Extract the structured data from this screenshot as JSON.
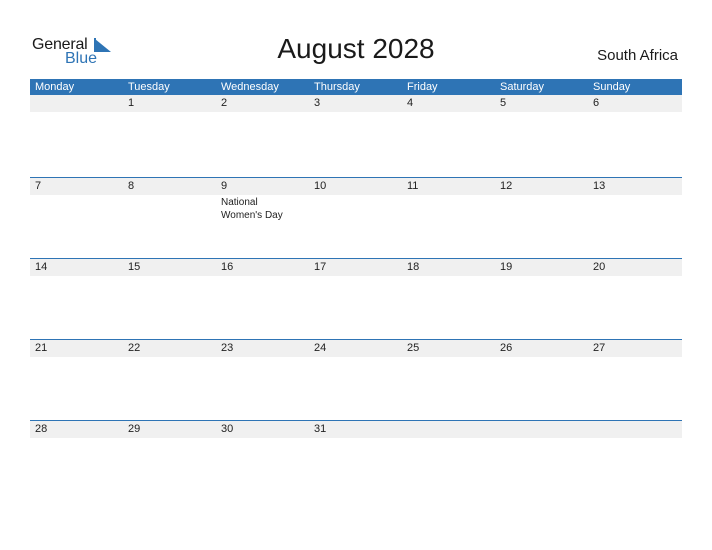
{
  "logo": {
    "general": "General",
    "blue": "Blue"
  },
  "title": "August 2028",
  "country": "South Africa",
  "weekdays": [
    "Monday",
    "Tuesday",
    "Wednesday",
    "Thursday",
    "Friday",
    "Saturday",
    "Sunday"
  ],
  "weeks": [
    {
      "days": [
        "",
        "1",
        "2",
        "3",
        "4",
        "5",
        "6"
      ],
      "events": [
        "",
        "",
        "",
        "",
        "",
        "",
        ""
      ]
    },
    {
      "days": [
        "7",
        "8",
        "9",
        "10",
        "11",
        "12",
        "13"
      ],
      "events": [
        "",
        "",
        "National Women's Day",
        "",
        "",
        "",
        ""
      ]
    },
    {
      "days": [
        "14",
        "15",
        "16",
        "17",
        "18",
        "19",
        "20"
      ],
      "events": [
        "",
        "",
        "",
        "",
        "",
        "",
        ""
      ]
    },
    {
      "days": [
        "21",
        "22",
        "23",
        "24",
        "25",
        "26",
        "27"
      ],
      "events": [
        "",
        "",
        "",
        "",
        "",
        "",
        ""
      ]
    },
    {
      "days": [
        "28",
        "29",
        "30",
        "31",
        "",
        "",
        ""
      ],
      "events": [
        "",
        "",
        "",
        "",
        "",
        "",
        ""
      ]
    }
  ],
  "colors": {
    "accent": "#2e74b5",
    "dayBar": "#f0f0f0"
  }
}
